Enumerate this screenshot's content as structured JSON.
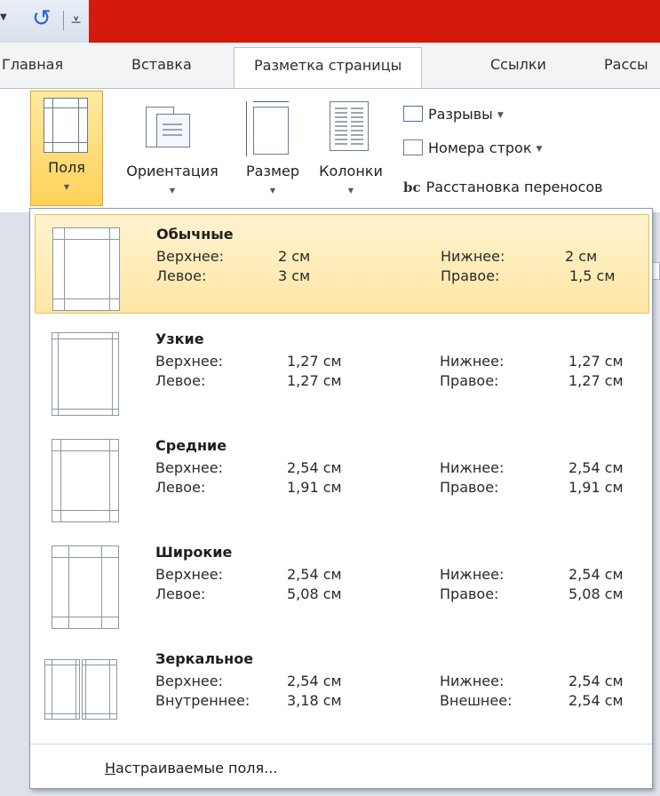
{
  "qat": {
    "arrow_icon": "dropdown-arrow-icon",
    "undo_icon": "undo-icon",
    "more_icon": "customize-qat-icon"
  },
  "tabs": [
    {
      "label": "Главная"
    },
    {
      "label": "Вставка"
    },
    {
      "label": "Разметка страницы"
    },
    {
      "label": "Ссылки"
    },
    {
      "label": "Рассы"
    }
  ],
  "ribbon": {
    "margins": {
      "label": "Поля"
    },
    "orientation": {
      "label": "Ориентация"
    },
    "size": {
      "label": "Размер"
    },
    "columns": {
      "label": "Колонки"
    },
    "breaks": {
      "label": "Разрывы"
    },
    "line_numbers": {
      "label": "Номера строк"
    },
    "hyphenation": {
      "label": "Расстановка переносов",
      "icon_text": "bc"
    }
  },
  "presets": [
    {
      "name": "Обычные",
      "rows": [
        {
          "l_label": "Верхнее:",
          "l_value": "2 см",
          "r_label": "Нижнее:",
          "r_value": "2 см"
        },
        {
          "l_label": "Левое:",
          "l_value": "3 см",
          "r_label": "Правое:",
          "r_value": "1,5 см"
        }
      ]
    },
    {
      "name": "Узкие",
      "rows": [
        {
          "l_label": "Верхнее:",
          "l_value": "1,27 см",
          "r_label": "Нижнее:",
          "r_value": "1,27 см"
        },
        {
          "l_label": "Левое:",
          "l_value": "1,27 см",
          "r_label": "Правое:",
          "r_value": "1,27 см"
        }
      ]
    },
    {
      "name": "Средние",
      "rows": [
        {
          "l_label": "Верхнее:",
          "l_value": "2,54 см",
          "r_label": "Нижнее:",
          "r_value": "2,54 см"
        },
        {
          "l_label": "Левое:",
          "l_value": "1,91 см",
          "r_label": "Правое:",
          "r_value": "1,91 см"
        }
      ]
    },
    {
      "name": "Широкие",
      "rows": [
        {
          "l_label": "Верхнее:",
          "l_value": "2,54 см",
          "r_label": "Нижнее:",
          "r_value": "2,54 см"
        },
        {
          "l_label": "Левое:",
          "l_value": "5,08 см",
          "r_label": "Правое:",
          "r_value": "5,08 см"
        }
      ]
    },
    {
      "name": "Зеркальное",
      "rows": [
        {
          "l_label": "Верхнее:",
          "l_value": "2,54 см",
          "r_label": "Нижнее:",
          "r_value": "2,54 см"
        },
        {
          "l_label": "Внутреннее:",
          "l_value": "3,18 см",
          "r_label": "Внешнее:",
          "r_value": "2,54 см"
        }
      ]
    }
  ],
  "custom_margins": {
    "label": "Настраиваемые поля...",
    "accel": "Н",
    "rest": "астраиваемые поля..."
  },
  "colors": {
    "title_bar": "#d51a0d",
    "selection": "#ffe6a6",
    "selection_border": "#efbf56"
  }
}
